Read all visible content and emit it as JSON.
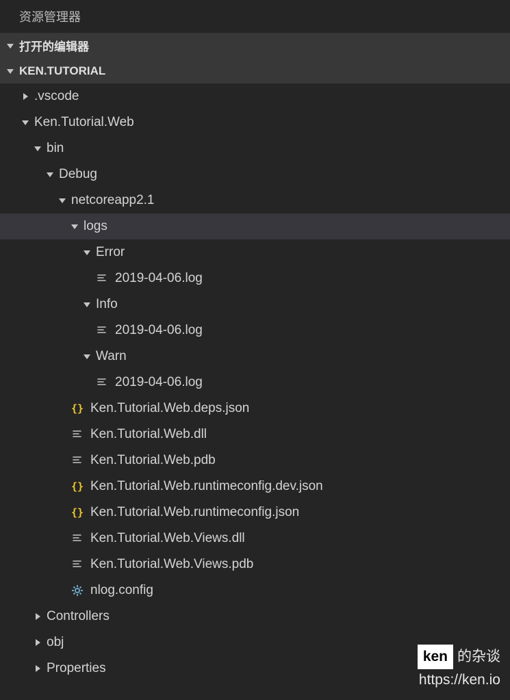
{
  "explorerTitle": "资源管理器",
  "sections": {
    "openEditors": "打开的编辑器",
    "project": "KEN.TUTORIAL"
  },
  "tree": [
    {
      "depth": 0,
      "type": "folder",
      "state": "collapsed",
      "label": ".vscode",
      "selected": false
    },
    {
      "depth": 0,
      "type": "folder",
      "state": "expanded",
      "label": "Ken.Tutorial.Web",
      "selected": false
    },
    {
      "depth": 1,
      "type": "folder",
      "state": "expanded",
      "label": "bin",
      "selected": false
    },
    {
      "depth": 2,
      "type": "folder",
      "state": "expanded",
      "label": "Debug",
      "selected": false
    },
    {
      "depth": 3,
      "type": "folder",
      "state": "expanded",
      "label": "netcoreapp2.1",
      "selected": false
    },
    {
      "depth": 4,
      "type": "folder",
      "state": "expanded",
      "label": "logs",
      "selected": true
    },
    {
      "depth": 5,
      "type": "folder",
      "state": "expanded",
      "label": "Error",
      "selected": false
    },
    {
      "depth": 6,
      "type": "file",
      "icon": "file",
      "label": "2019-04-06.log",
      "selected": false
    },
    {
      "depth": 5,
      "type": "folder",
      "state": "expanded",
      "label": "Info",
      "selected": false
    },
    {
      "depth": 6,
      "type": "file",
      "icon": "file",
      "label": "2019-04-06.log",
      "selected": false
    },
    {
      "depth": 5,
      "type": "folder",
      "state": "expanded",
      "label": "Warn",
      "selected": false
    },
    {
      "depth": 6,
      "type": "file",
      "icon": "file",
      "label": "2019-04-06.log",
      "selected": false
    },
    {
      "depth": 4,
      "type": "file",
      "icon": "json",
      "label": "Ken.Tutorial.Web.deps.json",
      "selected": false
    },
    {
      "depth": 4,
      "type": "file",
      "icon": "file",
      "label": "Ken.Tutorial.Web.dll",
      "selected": false
    },
    {
      "depth": 4,
      "type": "file",
      "icon": "file",
      "label": "Ken.Tutorial.Web.pdb",
      "selected": false
    },
    {
      "depth": 4,
      "type": "file",
      "icon": "json",
      "label": "Ken.Tutorial.Web.runtimeconfig.dev.json",
      "selected": false
    },
    {
      "depth": 4,
      "type": "file",
      "icon": "json",
      "label": "Ken.Tutorial.Web.runtimeconfig.json",
      "selected": false
    },
    {
      "depth": 4,
      "type": "file",
      "icon": "file",
      "label": "Ken.Tutorial.Web.Views.dll",
      "selected": false
    },
    {
      "depth": 4,
      "type": "file",
      "icon": "file",
      "label": "Ken.Tutorial.Web.Views.pdb",
      "selected": false
    },
    {
      "depth": 4,
      "type": "file",
      "icon": "gear",
      "label": "nlog.config",
      "selected": false
    },
    {
      "depth": 1,
      "type": "folder",
      "state": "collapsed",
      "label": "Controllers",
      "selected": false
    },
    {
      "depth": 1,
      "type": "folder",
      "state": "collapsed",
      "label": "obj",
      "selected": false
    },
    {
      "depth": 1,
      "type": "folder",
      "state": "collapsed",
      "label": "Properties",
      "selected": false
    }
  ],
  "watermark": {
    "brand": "ken",
    "suffix": "的杂谈",
    "url": "https://ken.io"
  },
  "colors": {
    "jsonIcon": "#f0c828",
    "gearIcon": "#6fa6c2",
    "fileIcon": "#c5c5c5",
    "arrow": "#c5c5c5"
  }
}
